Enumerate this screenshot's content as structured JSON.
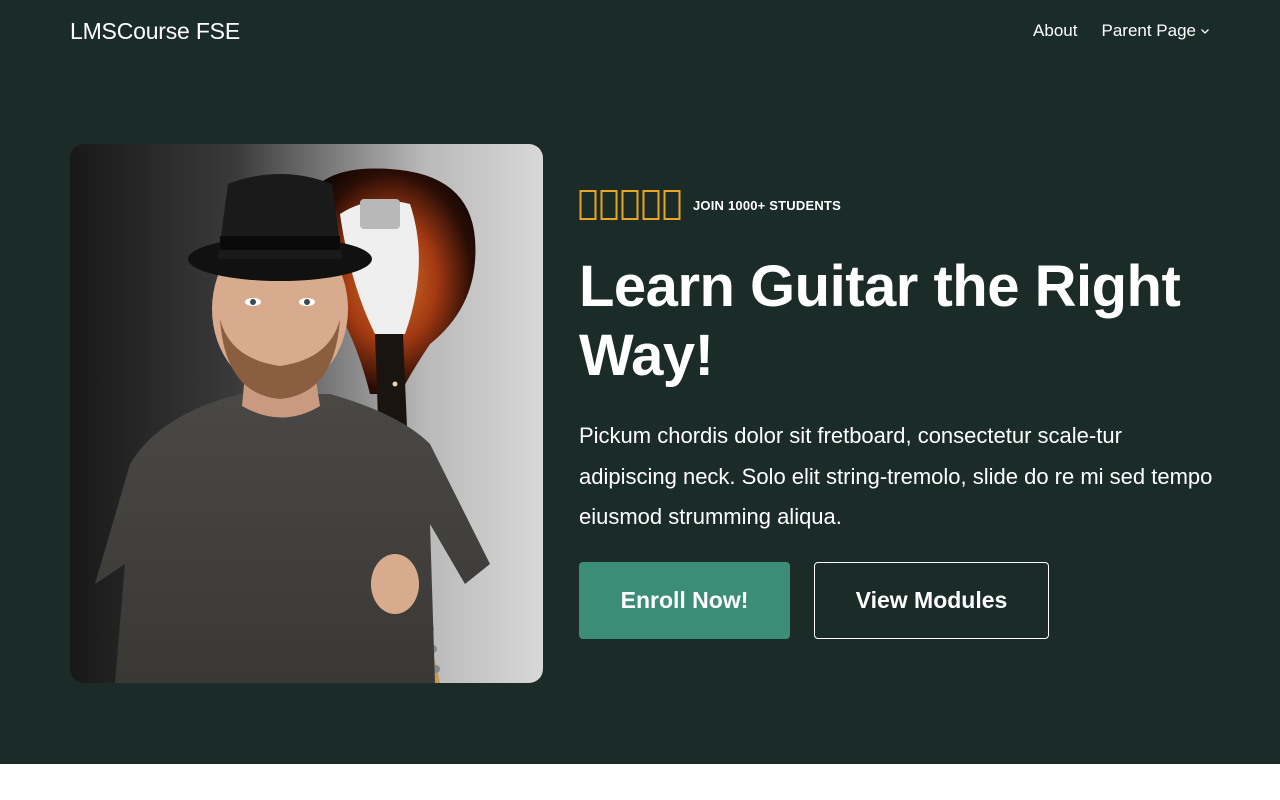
{
  "header": {
    "site_title": "LMSCourse FSE",
    "nav": [
      {
        "label": "About"
      },
      {
        "label": "Parent Page",
        "has_submenu": true
      }
    ]
  },
  "hero": {
    "rating": {
      "stars": 5,
      "star_color": "#e9a623",
      "badge": "JOIN 1000+ STUDENTS"
    },
    "headline": "Learn Guitar the Right Way!",
    "description": "Pickum chordis dolor sit fretboard, consectetur scale-tur adipiscing neck. Solo elit string-tremolo, slide do re mi sed tempo eiusmod strumming aliqua.",
    "primary_button": "Enroll Now!",
    "secondary_button": "View Modules",
    "image_icon": "guitarist-photo"
  },
  "colors": {
    "hero_background": "#1b2b28",
    "primary_button": "#3b8d77",
    "text": "#ffffff"
  }
}
